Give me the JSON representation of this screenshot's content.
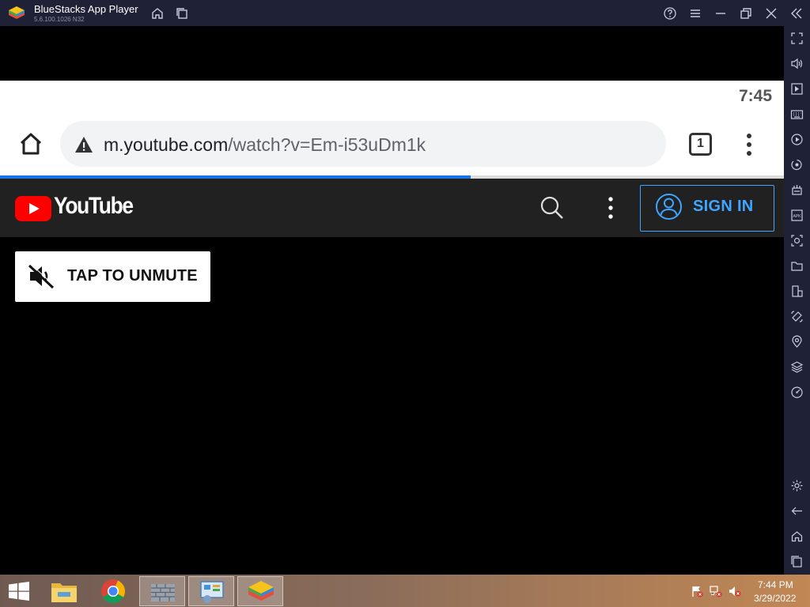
{
  "window": {
    "title": "BlueStacks App Player",
    "version": "5.6.100.1026 N32",
    "controls": [
      "help-icon",
      "menu-icon",
      "minimize-icon",
      "restore-icon",
      "close-icon",
      "collapse-sidebar-icon"
    ]
  },
  "side_toolbar": {
    "icons": [
      "fullscreen-icon",
      "volume-icon",
      "media-icon",
      "keyboard-icon",
      "record-icon",
      "replay-icon",
      "macro-icon",
      "install-apk-icon",
      "screenshot-icon",
      "folder-icon",
      "multi-instance-icon",
      "rotate-icon",
      "location-icon",
      "layers-icon",
      "eco-mode-icon",
      "settings-icon",
      "back-icon",
      "home-icon",
      "recent-apps-icon"
    ]
  },
  "android": {
    "status_time": "7:45",
    "browser": {
      "url_domain": "m.youtube.com",
      "url_path": "/watch?v=Em-i53uDm1k",
      "tab_count": "1",
      "load_progress": 0.6
    },
    "youtube": {
      "wordmark": "YouTube",
      "sign_in_label": "SIGN IN",
      "unmute_label": "TAP TO UNMUTE"
    }
  },
  "taskbar": {
    "apps": [
      "file-explorer-icon",
      "chrome-icon",
      "firewall-icon",
      "control-panel-icon",
      "bluestacks-icon"
    ],
    "time": "7:44 PM",
    "date": "3/29/2022"
  },
  "colors": {
    "titlebar": "#1f2236",
    "youtube_red": "#ff0000",
    "sign_in_blue": "#3ea6ff",
    "progress_blue": "#1a73e8"
  }
}
